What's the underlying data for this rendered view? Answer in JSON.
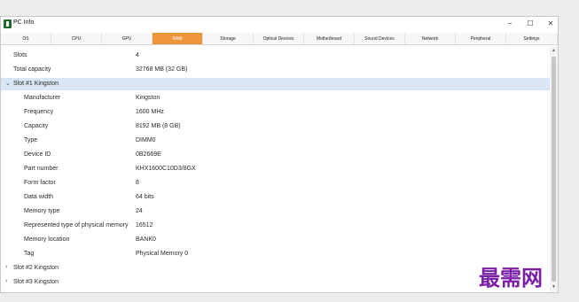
{
  "window": {
    "title": "PC Info",
    "controls": {
      "minimize": "−",
      "maximize": "☐",
      "close": "✕"
    }
  },
  "tabs": [
    {
      "label": "OS"
    },
    {
      "label": "CPU"
    },
    {
      "label": "GPU"
    },
    {
      "label": "RAM",
      "active": true
    },
    {
      "label": "Storage"
    },
    {
      "label": "Optical Devices"
    },
    {
      "label": "Motherboard"
    },
    {
      "label": "Sound Devices"
    },
    {
      "label": "Network"
    },
    {
      "label": "Peripheral"
    },
    {
      "label": "Settings"
    }
  ],
  "summary": {
    "slots": {
      "label": "Slots",
      "value": "4"
    },
    "total_capacity": {
      "label": "Total capacity",
      "value": "32768 MB (32 GB)"
    }
  },
  "slot1": {
    "header": "Slot #1 Kingston",
    "expanded": true,
    "properties": [
      {
        "label": "Manufacturer",
        "value": "Kingston"
      },
      {
        "label": "Frequency",
        "value": "1600 MHz"
      },
      {
        "label": "Capacity",
        "value": "8192 MB (8 GB)"
      },
      {
        "label": "Type",
        "value": "DIMM0"
      },
      {
        "label": "Device ID",
        "value": "0B2669E"
      },
      {
        "label": "Part number",
        "value": "KHX1600C10D3/8GX"
      },
      {
        "label": "Form factor",
        "value": "8"
      },
      {
        "label": "Data width",
        "value": "64 bits"
      },
      {
        "label": "Memory type",
        "value": "24"
      },
      {
        "label": "Represented type of physical memory",
        "value": "16512"
      },
      {
        "label": "Memory location",
        "value": "BANK0"
      },
      {
        "label": "Tag",
        "value": "Physical Memory 0"
      }
    ]
  },
  "collapsed_slots": [
    {
      "header": "Slot #2 Kingston"
    },
    {
      "header": "Slot #3 Kingston"
    }
  ],
  "icons": {
    "expanded": "⌄",
    "collapsed": "›",
    "scroll_up": "▲",
    "scroll_down": "▼"
  },
  "watermark": "最需网",
  "colors": {
    "active_tab": "#f0943a",
    "selected_row": "#d8e6f5",
    "watermark": "#7a1fa6"
  }
}
